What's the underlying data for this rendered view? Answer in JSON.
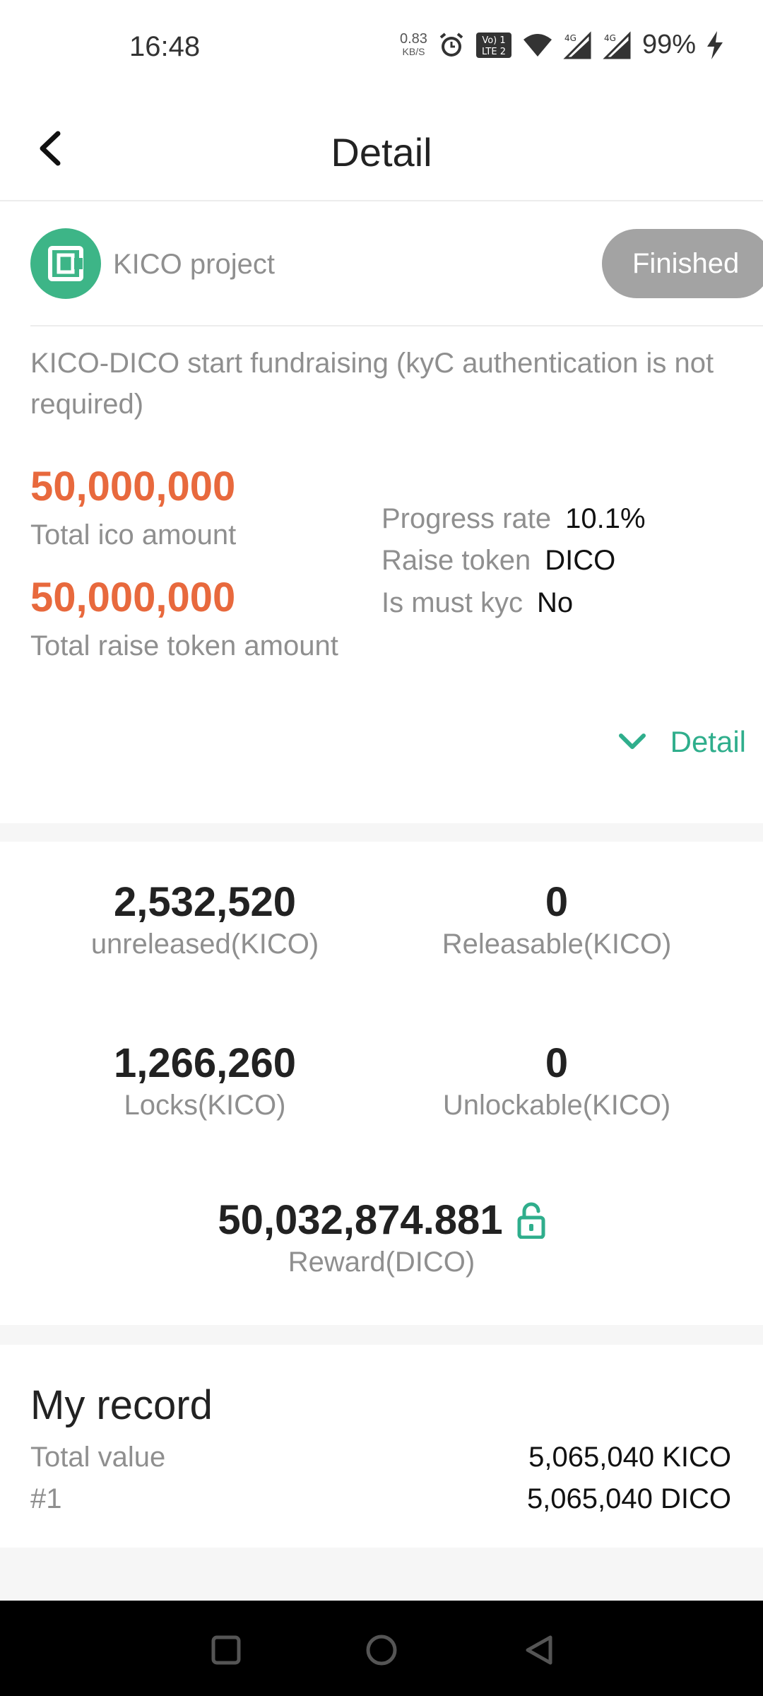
{
  "status_bar": {
    "time": "16:48",
    "net_speed_value": "0.83",
    "net_speed_unit": "KB/S",
    "volte_label": "Vo) 1 LTE 2",
    "battery": "99%",
    "icons": [
      "alarm-icon",
      "volte-icon",
      "wifi-icon",
      "signal-4g-icon",
      "signal-4g-icon",
      "charging-icon"
    ]
  },
  "header": {
    "title": "Detail",
    "back_icon": "back-arrow-icon"
  },
  "project": {
    "name": "KICO project",
    "status": "Finished",
    "description": "KICO-DICO start fundraising (kyC authentication is not required)",
    "accent_color": "#e8693d",
    "brand_color": "#3db587"
  },
  "amounts": {
    "total_ico_value": "50,000,000",
    "total_ico_label": "Total ico amount",
    "total_raise_value": "50,000,000",
    "total_raise_label": "Total raise token amount"
  },
  "info": {
    "progress_label": "Progress rate",
    "progress_value": "10.1%",
    "raise_token_label": "Raise token",
    "raise_token_value": "DICO",
    "kyc_label": "Is must kyc",
    "kyc_value": "No"
  },
  "detail_toggle": {
    "label": "Detail",
    "icon": "chevron-down-icon"
  },
  "stats": {
    "unreleased_value": "2,532,520",
    "unreleased_label": "unreleased(KICO)",
    "releasable_value": "0",
    "releasable_label": "Releasable(KICO)",
    "locks_value": "1,266,260",
    "locks_label": "Locks(KICO)",
    "unlockable_value": "0",
    "unlockable_label": "Unlockable(KICO)",
    "reward_value": "50,032,874.881",
    "reward_label": "Reward(DICO)",
    "reward_icon": "unlock-icon"
  },
  "record": {
    "title": "My record",
    "rows": [
      {
        "label": "Total value",
        "value": "5,065,040 KICO"
      },
      {
        "label": "#1",
        "value": "5,065,040 DICO"
      }
    ]
  },
  "nav": {
    "buttons": [
      "recents-icon",
      "home-icon",
      "back-triangle-icon"
    ]
  }
}
